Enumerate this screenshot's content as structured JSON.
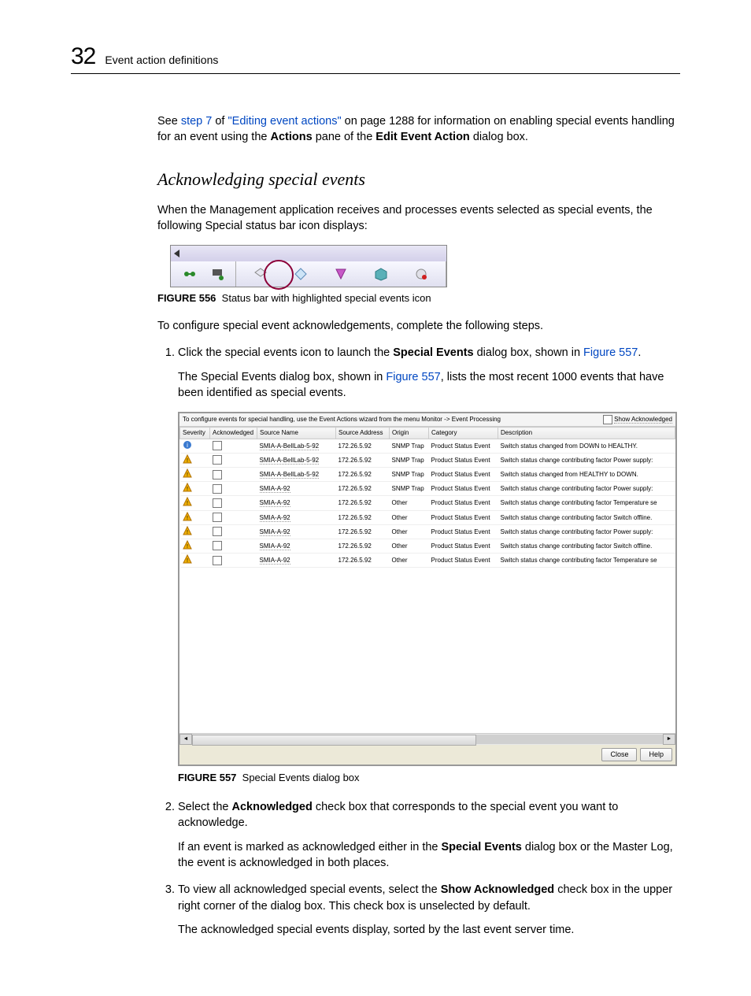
{
  "header": {
    "chapter_number": "32",
    "title": "Event action definitions"
  },
  "intro": {
    "see_prefix": "See ",
    "step7": "step 7",
    "of": " of ",
    "editing_link": "\"Editing event actions\"",
    "after_link": " on page 1288 for information on enabling special events handling for an event using the ",
    "actions_bold": "Actions",
    "pane_of": " pane of the ",
    "edit_event_action": "Edit Event Action",
    "dialog_box": " dialog box."
  },
  "section_heading": "Acknowledging special events",
  "para1": "When the Management application receives and processes events selected as special events, the following Special status bar icon displays:",
  "figure556": {
    "label": "FIGURE 556",
    "caption": "Status bar with highlighted special events icon"
  },
  "para2": "To configure special event acknowledgements, complete the following steps.",
  "step1": {
    "text_before": "Click the special events icon to launch the ",
    "bold": "Special Events",
    "text_after": " dialog box, shown in ",
    "fig_link": "Figure 557",
    "period": ".",
    "para2_before": "The Special Events dialog box, shown in ",
    "para2_link": "Figure 557",
    "para2_after": ", lists the most recent 1000 events that have been identified as special events."
  },
  "dialog": {
    "instruction": "To configure events for special handling, use the Event Actions wizard from the menu Monitor -> Event Processing",
    "show_ack": "Show Acknowledged",
    "columns": [
      "Severity",
      "Acknowledged",
      "Source Name",
      "Source Address",
      "Origin",
      "Category",
      "Description"
    ],
    "rows": [
      {
        "sev": "info",
        "src": "SMIA-A-BellLab-5-92",
        "addr": "172.26.5.92",
        "origin": "SNMP Trap",
        "cat": "Product Status Event",
        "desc": "Switch status changed from DOWN to HEALTHY."
      },
      {
        "sev": "warn",
        "src": "SMIA-A-BellLab-5-92",
        "addr": "172.26.5.92",
        "origin": "SNMP Trap",
        "cat": "Product Status Event",
        "desc": "Switch status change contributing factor Power supply:"
      },
      {
        "sev": "warn",
        "src": "SMIA-A-BellLab-5-92",
        "addr": "172.26.5.92",
        "origin": "SNMP Trap",
        "cat": "Product Status Event",
        "desc": "Switch status changed from HEALTHY to DOWN."
      },
      {
        "sev": "warn",
        "src": "SMIA-A-92",
        "addr": "172.26.5.92",
        "origin": "SNMP Trap",
        "cat": "Product Status Event",
        "desc": "Switch status change contributing factor Power supply:"
      },
      {
        "sev": "warn",
        "src": "SMIA-A-92",
        "addr": "172.26.5.92",
        "origin": "Other",
        "cat": "Product Status Event",
        "desc": "Switch status change contributing factor Temperature se"
      },
      {
        "sev": "warn",
        "src": "SMIA-A-92",
        "addr": "172.26.5.92",
        "origin": "Other",
        "cat": "Product Status Event",
        "desc": "Switch status change contributing factor Switch offline."
      },
      {
        "sev": "warn",
        "src": "SMIA-A-92",
        "addr": "172.26.5.92",
        "origin": "Other",
        "cat": "Product Status Event",
        "desc": "Switch status change contributing factor Power supply:"
      },
      {
        "sev": "warn",
        "src": "SMIA-A-92",
        "addr": "172.26.5.92",
        "origin": "Other",
        "cat": "Product Status Event",
        "desc": "Switch status change contributing factor Switch offline."
      },
      {
        "sev": "warn",
        "src": "SMIA-A-92",
        "addr": "172.26.5.92",
        "origin": "Other",
        "cat": "Product Status Event",
        "desc": "Switch status change contributing factor Temperature se"
      }
    ],
    "close": "Close",
    "help": "Help"
  },
  "figure557": {
    "label": "FIGURE 557",
    "caption": "Special Events dialog box"
  },
  "step2": {
    "before": "Select the ",
    "bold": "Acknowledged",
    "after": " check box that corresponds to the special event you want to acknowledge.",
    "para2_before": "If an event is marked as acknowledged either in the ",
    "para2_bold": "Special Events",
    "para2_after": " dialog box or the Master Log, the event is acknowledged in both places."
  },
  "step3": {
    "before": "To view all acknowledged special events, select the ",
    "bold": "Show Acknowledged",
    "after": " check box in the upper right corner of the dialog box. This check box is unselected by default.",
    "para2": "The acknowledged special events display, sorted by the last event server time."
  }
}
